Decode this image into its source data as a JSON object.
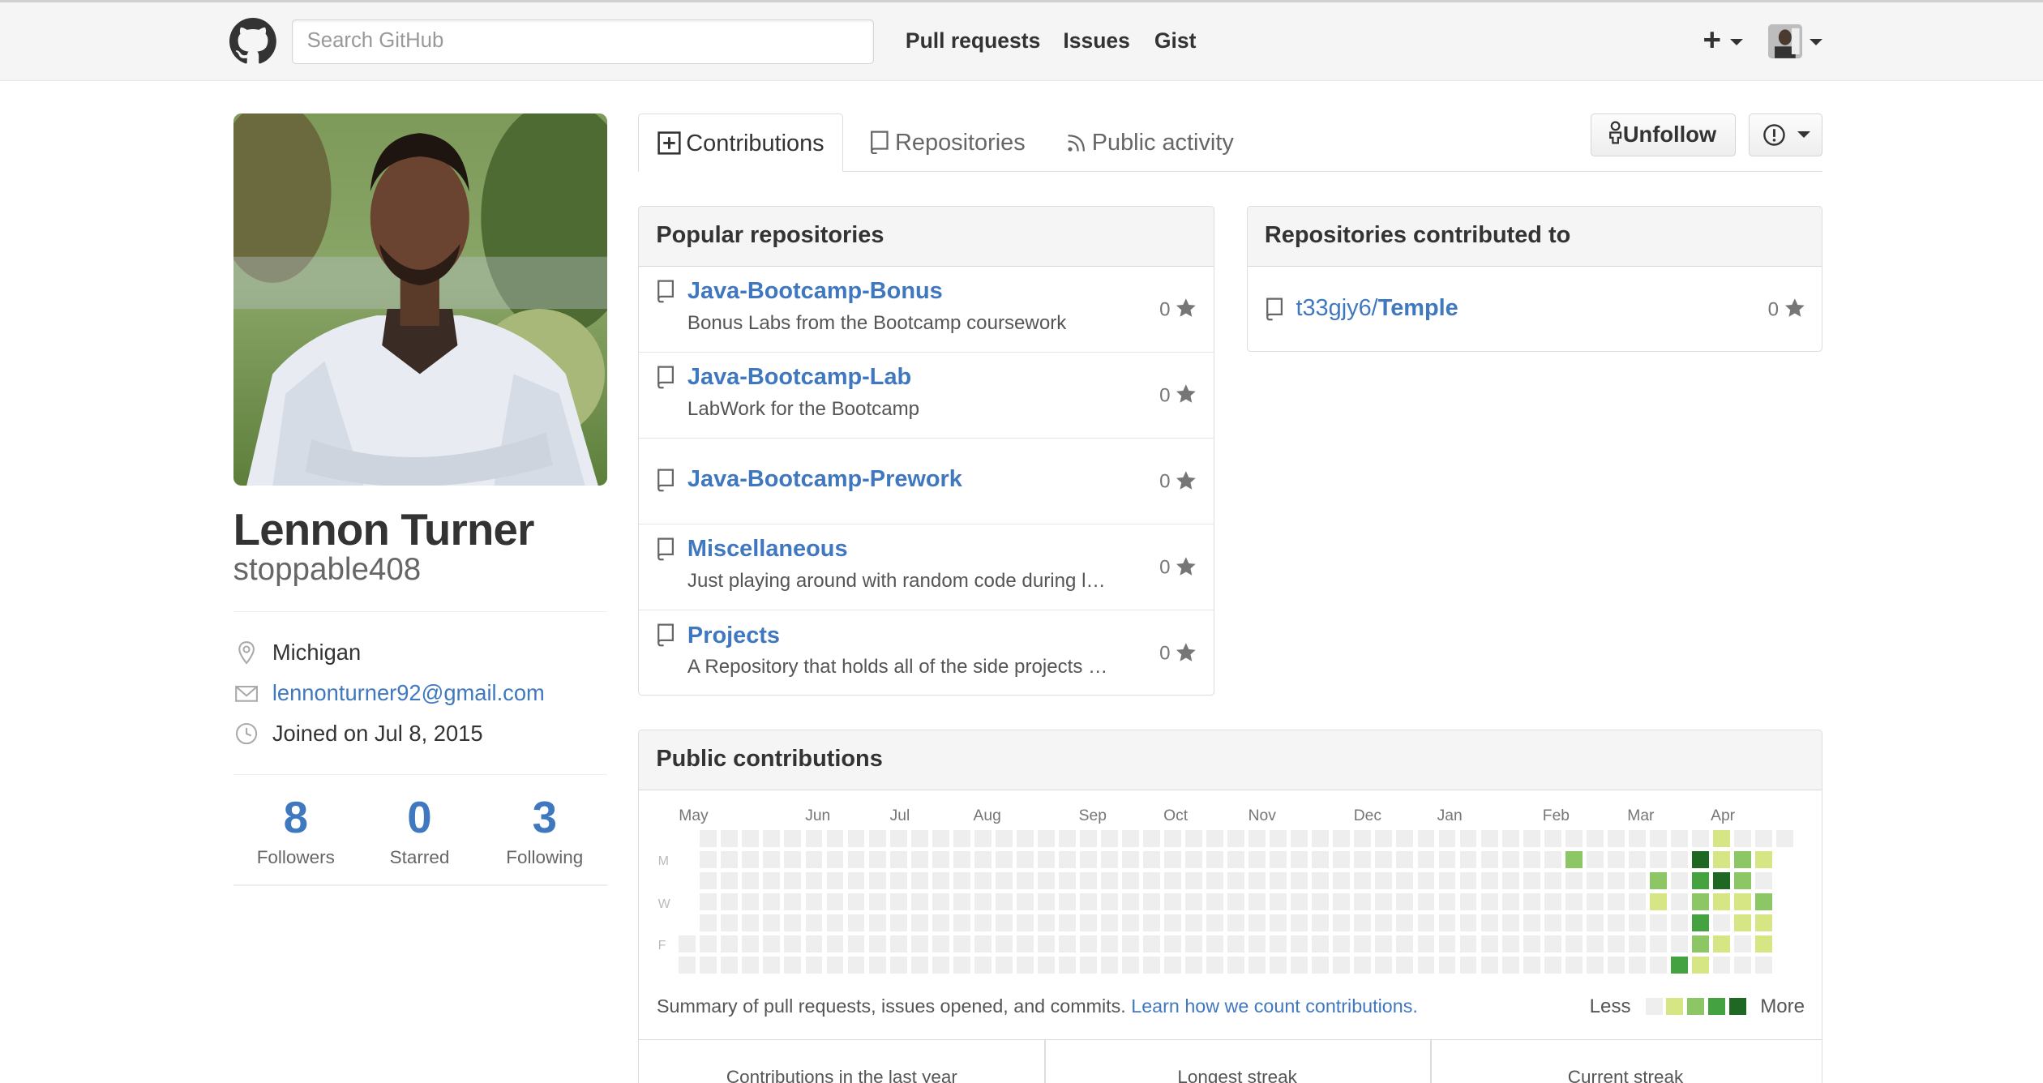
{
  "header": {
    "search_placeholder": "Search GitHub",
    "nav": [
      "Pull requests",
      "Issues",
      "Gist"
    ],
    "plus_label": "+"
  },
  "profile": {
    "name": "Lennon Turner",
    "username": "stoppable408",
    "location": "Michigan",
    "email": "lennonturner92@gmail.com",
    "joined": "Joined on Jul 8, 2015",
    "stats": [
      {
        "num": "8",
        "label": "Followers"
      },
      {
        "num": "0",
        "label": "Starred"
      },
      {
        "num": "3",
        "label": "Following"
      }
    ]
  },
  "tabs": {
    "contributions": "Contributions",
    "repositories": "Repositories",
    "activity": "Public activity",
    "unfollow": "Unfollow"
  },
  "popular": {
    "title": "Popular repositories",
    "repos": [
      {
        "name": "Java-Bootcamp-Bonus",
        "desc": "Bonus Labs from the Bootcamp coursework",
        "stars": "0"
      },
      {
        "name": "Java-Bootcamp-Lab",
        "desc": "LabWork for the Bootcamp",
        "stars": "0"
      },
      {
        "name": "Java-Bootcamp-Prework",
        "desc": "",
        "stars": "0"
      },
      {
        "name": "Miscellaneous",
        "desc": "Just playing around with random code during l…",
        "stars": "0"
      },
      {
        "name": "Projects",
        "desc": "A Repository that holds all of the side projects …",
        "stars": "0"
      }
    ]
  },
  "contributed": {
    "title": "Repositories contributed to",
    "repo_owner": "t33gjy6/",
    "repo_name": "Temple",
    "stars": "0"
  },
  "contributions": {
    "title": "Public contributions",
    "months": [
      "May",
      "Jun",
      "Jul",
      "Aug",
      "Sep",
      "Oct",
      "Nov",
      "Dec",
      "Jan",
      "Feb",
      "Mar",
      "Apr"
    ],
    "days": [
      "M",
      "W",
      "F"
    ],
    "summary": "Summary of pull requests, issues opened, and commits.",
    "learn_link": "Learn how we count contributions.",
    "less": "Less",
    "more": "More",
    "levels": [
      "#eeeeee",
      "#d6e685",
      "#8cc665",
      "#44a340",
      "#1e6823"
    ],
    "active_cells": [
      {
        "week": 42,
        "day": 1,
        "level": 2
      },
      {
        "week": 46,
        "day": 2,
        "level": 2
      },
      {
        "week": 46,
        "day": 3,
        "level": 1
      },
      {
        "week": 47,
        "day": 6,
        "level": 3
      },
      {
        "week": 48,
        "day": 1,
        "level": 4
      },
      {
        "week": 48,
        "day": 2,
        "level": 3
      },
      {
        "week": 48,
        "day": 3,
        "level": 2
      },
      {
        "week": 48,
        "day": 4,
        "level": 3
      },
      {
        "week": 48,
        "day": 5,
        "level": 2
      },
      {
        "week": 48,
        "day": 6,
        "level": 1
      },
      {
        "week": 49,
        "day": 0,
        "level": 1
      },
      {
        "week": 49,
        "day": 1,
        "level": 1
      },
      {
        "week": 49,
        "day": 2,
        "level": 4
      },
      {
        "week": 49,
        "day": 3,
        "level": 1
      },
      {
        "week": 49,
        "day": 5,
        "level": 1
      },
      {
        "week": 50,
        "day": 1,
        "level": 2
      },
      {
        "week": 50,
        "day": 2,
        "level": 2
      },
      {
        "week": 50,
        "day": 3,
        "level": 1
      },
      {
        "week": 50,
        "day": 4,
        "level": 1
      },
      {
        "week": 51,
        "day": 1,
        "level": 1
      },
      {
        "week": 51,
        "day": 3,
        "level": 2
      },
      {
        "week": 51,
        "day": 4,
        "level": 1
      },
      {
        "week": 51,
        "day": 5,
        "level": 1
      }
    ],
    "col_labels": [
      "Contributions in the last year",
      "Longest streak",
      "Current streak"
    ]
  }
}
